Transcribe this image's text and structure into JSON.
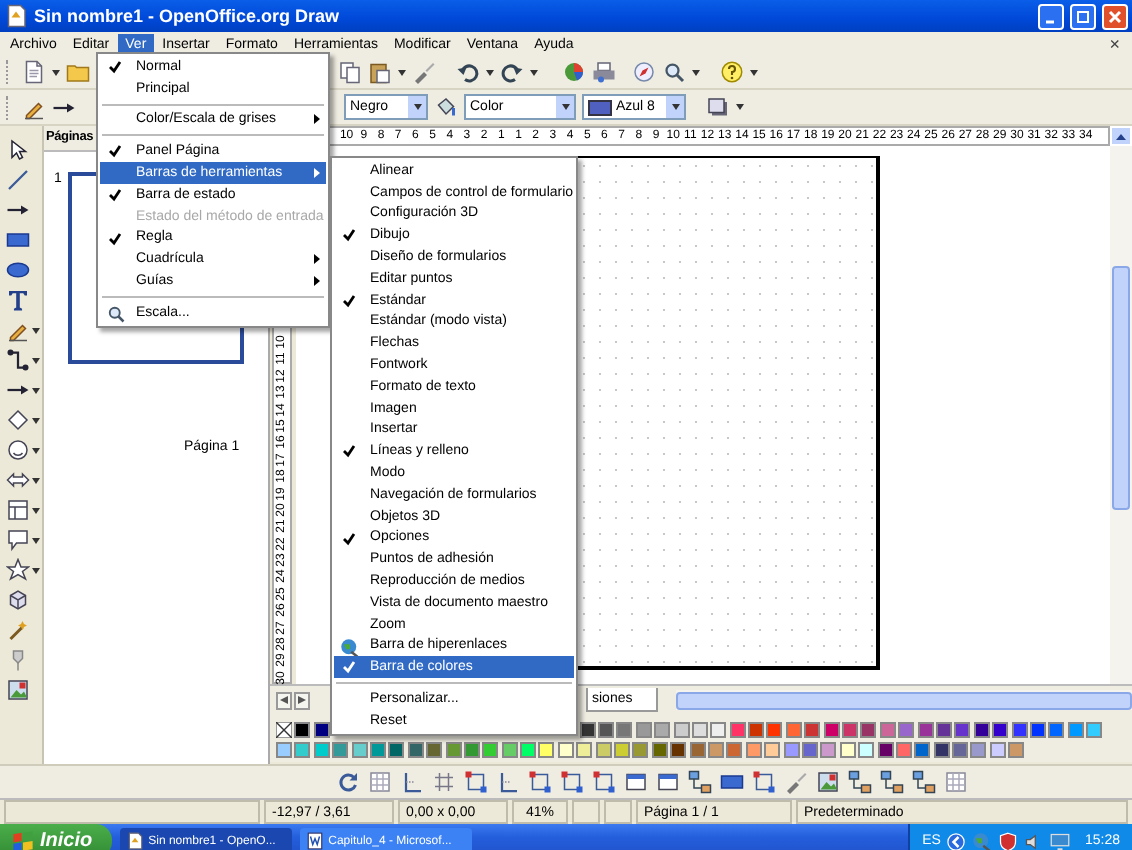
{
  "window": {
    "title": "Sin nombre1 - OpenOffice.org Draw",
    "close_document": "×"
  },
  "menu_bar": [
    {
      "label": "Archivo",
      "selected": false
    },
    {
      "label": "Editar",
      "selected": false
    },
    {
      "label": "Ver",
      "selected": true
    },
    {
      "label": "Insertar",
      "selected": false
    },
    {
      "label": "Formato",
      "selected": false
    },
    {
      "label": "Herramientas",
      "selected": false
    },
    {
      "label": "Modificar",
      "selected": false
    },
    {
      "label": "Ventana",
      "selected": false
    },
    {
      "label": "Ayuda",
      "selected": false
    }
  ],
  "toolbar": {
    "line_color": "Negro",
    "area_style": "Color",
    "fill": "Azul 8"
  },
  "horizontal_ruler": [
    "10",
    "9",
    "8",
    "7",
    "6",
    "5",
    "4",
    "3",
    "2",
    "1",
    "1",
    "2",
    "3",
    "4",
    "5",
    "6",
    "7",
    "8",
    "9",
    "10",
    "11",
    "12",
    "13",
    "14",
    "15",
    "16",
    "17",
    "18",
    "19",
    "20",
    "21",
    "22",
    "23",
    "24",
    "25",
    "26",
    "27",
    "28",
    "29",
    "30",
    "31",
    "32",
    "33",
    "34"
  ],
  "vertical_ruler": [
    "10",
    "11",
    "12",
    "13",
    "14",
    "15",
    "16",
    "17",
    "18",
    "19",
    "20",
    "21",
    "22",
    "23",
    "24",
    "25",
    "26",
    "27",
    "28",
    "29",
    "30"
  ],
  "pages_panel": {
    "title": "Páginas",
    "pages": [
      {
        "number": "1",
        "label": "Página 1",
        "selected": true
      }
    ]
  },
  "layer_tab": "siones",
  "palette": {
    "row1_start": [
      {
        "color": "#000000"
      },
      {
        "color": "#000080"
      }
    ],
    "row1_end": [
      {
        "color": "#333333"
      },
      {
        "color": "#555555"
      },
      {
        "color": "#777777"
      },
      {
        "color": "#999999"
      },
      {
        "color": "#aaaaaa"
      },
      {
        "color": "#cccccc"
      },
      {
        "color": "#dddddd"
      },
      {
        "color": "#eeeeee"
      },
      {
        "color": "#ff3366"
      },
      {
        "color": "#cc3300"
      },
      {
        "color": "#ff3300"
      },
      {
        "color": "#ff6633"
      },
      {
        "color": "#cc3333"
      },
      {
        "color": "#cc0066"
      },
      {
        "color": "#cc3366"
      },
      {
        "color": "#993366"
      },
      {
        "color": "#cc6699"
      },
      {
        "color": "#9966cc"
      },
      {
        "color": "#993399"
      },
      {
        "color": "#663399"
      },
      {
        "color": "#6633cc"
      },
      {
        "color": "#330099"
      },
      {
        "color": "#3300cc"
      },
      {
        "color": "#3333ff"
      },
      {
        "color": "#0033ff"
      },
      {
        "color": "#0066ff"
      },
      {
        "color": "#0099ff"
      },
      {
        "color": "#33ccff"
      }
    ],
    "row2": [
      {
        "color": "#99ccff"
      },
      {
        "color": "#33cccc"
      },
      {
        "color": "#00cccc"
      },
      {
        "color": "#339999"
      },
      {
        "color": "#66cccc"
      },
      {
        "color": "#009999"
      },
      {
        "color": "#006666"
      },
      {
        "color": "#336666"
      },
      {
        "color": "#666633"
      },
      {
        "color": "#669933"
      },
      {
        "color": "#339933"
      },
      {
        "color": "#33cc33"
      },
      {
        "color": "#66cc66"
      },
      {
        "color": "#00ff66"
      },
      {
        "color": "#ffff66"
      },
      {
        "color": "#ffffcc"
      },
      {
        "color": "#eeee99"
      },
      {
        "color": "#cccc66"
      },
      {
        "color": "#cccc33"
      },
      {
        "color": "#999933"
      },
      {
        "color": "#666600"
      },
      {
        "color": "#663300"
      },
      {
        "color": "#996633"
      },
      {
        "color": "#cc9966"
      },
      {
        "color": "#cc6633"
      },
      {
        "color": "#ff9966"
      },
      {
        "color": "#ffcc99"
      },
      {
        "color": "#9999ff"
      },
      {
        "color": "#6666cc"
      },
      {
        "color": "#cc99cc"
      },
      {
        "color": "#ffffcc"
      },
      {
        "color": "#ccffff"
      },
      {
        "color": "#660066"
      },
      {
        "color": "#ff6666"
      },
      {
        "color": "#0066cc"
      },
      {
        "color": "#333366"
      },
      {
        "color": "#666699"
      },
      {
        "color": "#9999cc"
      },
      {
        "color": "#ccccff"
      },
      {
        "color": "#cc9966"
      }
    ]
  },
  "status_bar": {
    "position": "-12,97 / 3,61",
    "size": "0,00 x 0,00",
    "zoom": "41%",
    "page": "Página 1 / 1",
    "style": "Predeterminado"
  },
  "taskbar": {
    "start": "Inicio",
    "tasks": [
      {
        "label": "Sin nombre1 - OpenO...",
        "selected": true
      },
      {
        "label": "Capitulo_4 - Microsof...",
        "selected": false
      }
    ],
    "language": "ES",
    "clock": "15:28"
  },
  "view_menu": {
    "items": [
      {
        "kind": "item",
        "label": "Normal",
        "checked": true,
        "submenu": false,
        "disabled": false,
        "selected": false
      },
      {
        "kind": "item",
        "label": "Principal",
        "checked": false,
        "submenu": false,
        "disabled": false,
        "selected": false
      },
      {
        "kind": "separator"
      },
      {
        "kind": "item",
        "label": "Color/Escala de grises",
        "checked": false,
        "submenu": true,
        "disabled": false,
        "selected": false
      },
      {
        "kind": "separator"
      },
      {
        "kind": "item",
        "label": "Panel Página",
        "checked": true,
        "submenu": false,
        "disabled": false,
        "selected": false
      },
      {
        "kind": "item",
        "label": "Barras de herramientas",
        "checked": false,
        "submenu": true,
        "disabled": false,
        "selected": true
      },
      {
        "kind": "item",
        "label": "Barra de estado",
        "checked": true,
        "submenu": false,
        "disabled": false,
        "selected": false
      },
      {
        "kind": "item",
        "label": "Estado del método de entrada",
        "checked": false,
        "submenu": false,
        "disabled": true,
        "selected": false
      },
      {
        "kind": "item",
        "label": "Regla",
        "checked": true,
        "submenu": false,
        "disabled": false,
        "selected": false
      },
      {
        "kind": "item",
        "label": "Cuadrícula",
        "checked": false,
        "submenu": true,
        "disabled": false,
        "selected": false
      },
      {
        "kind": "item",
        "label": "Guías",
        "checked": false,
        "submenu": true,
        "disabled": false,
        "selected": false
      },
      {
        "kind": "separator"
      },
      {
        "kind": "lens",
        "label": "Escala...",
        "checked": false,
        "submenu": false,
        "disabled": false,
        "selected": false
      }
    ]
  },
  "toolbars_menu": {
    "items": [
      {
        "kind": "item",
        "label": "Alinear",
        "checked": false,
        "selected": false
      },
      {
        "kind": "item",
        "label": "Campos de control de formulario",
        "checked": false,
        "selected": false
      },
      {
        "kind": "item",
        "label": "Configuración 3D",
        "checked": false,
        "selected": false
      },
      {
        "kind": "item",
        "label": "Dibujo",
        "checked": true,
        "selected": false
      },
      {
        "kind": "item",
        "label": "Diseño de formularios",
        "checked": false,
        "selected": false
      },
      {
        "kind": "item",
        "label": "Editar puntos",
        "checked": false,
        "selected": false
      },
      {
        "kind": "item",
        "label": "Estándar",
        "checked": true,
        "selected": false
      },
      {
        "kind": "item",
        "label": "Estándar (modo vista)",
        "checked": false,
        "selected": false
      },
      {
        "kind": "item",
        "label": "Flechas",
        "checked": false,
        "selected": false
      },
      {
        "kind": "item",
        "label": "Fontwork",
        "checked": false,
        "selected": false
      },
      {
        "kind": "item",
        "label": "Formato de texto",
        "checked": false,
        "selected": false
      },
      {
        "kind": "item",
        "label": "Imagen",
        "checked": false,
        "selected": false
      },
      {
        "kind": "item",
        "label": "Insertar",
        "checked": false,
        "selected": false
      },
      {
        "kind": "item",
        "label": "Líneas y relleno",
        "checked": true,
        "selected": false
      },
      {
        "kind": "item",
        "label": "Modo",
        "checked": false,
        "selected": false
      },
      {
        "kind": "item",
        "label": "Navegación de formularios",
        "checked": false,
        "selected": false
      },
      {
        "kind": "item",
        "label": "Objetos 3D",
        "checked": false,
        "selected": false
      },
      {
        "kind": "item",
        "label": "Opciones",
        "checked": true,
        "selected": false
      },
      {
        "kind": "item",
        "label": "Puntos de adhesión",
        "checked": false,
        "selected": false
      },
      {
        "kind": "item",
        "label": "Reproducción de medios",
        "checked": false,
        "selected": false
      },
      {
        "kind": "item",
        "label": "Vista de documento maestro",
        "checked": false,
        "selected": false
      },
      {
        "kind": "item",
        "label": "Zoom",
        "checked": false,
        "selected": false
      },
      {
        "kind": "globe",
        "label": "Barra de hiperenlaces",
        "checked": false,
        "selected": false
      },
      {
        "kind": "item",
        "label": "Barra de colores",
        "checked": true,
        "selected": true
      },
      {
        "kind": "separator"
      },
      {
        "kind": "item",
        "label": "Personalizar...",
        "checked": false,
        "selected": false
      },
      {
        "kind": "item",
        "label": "Reset",
        "checked": false,
        "selected": false
      }
    ]
  }
}
